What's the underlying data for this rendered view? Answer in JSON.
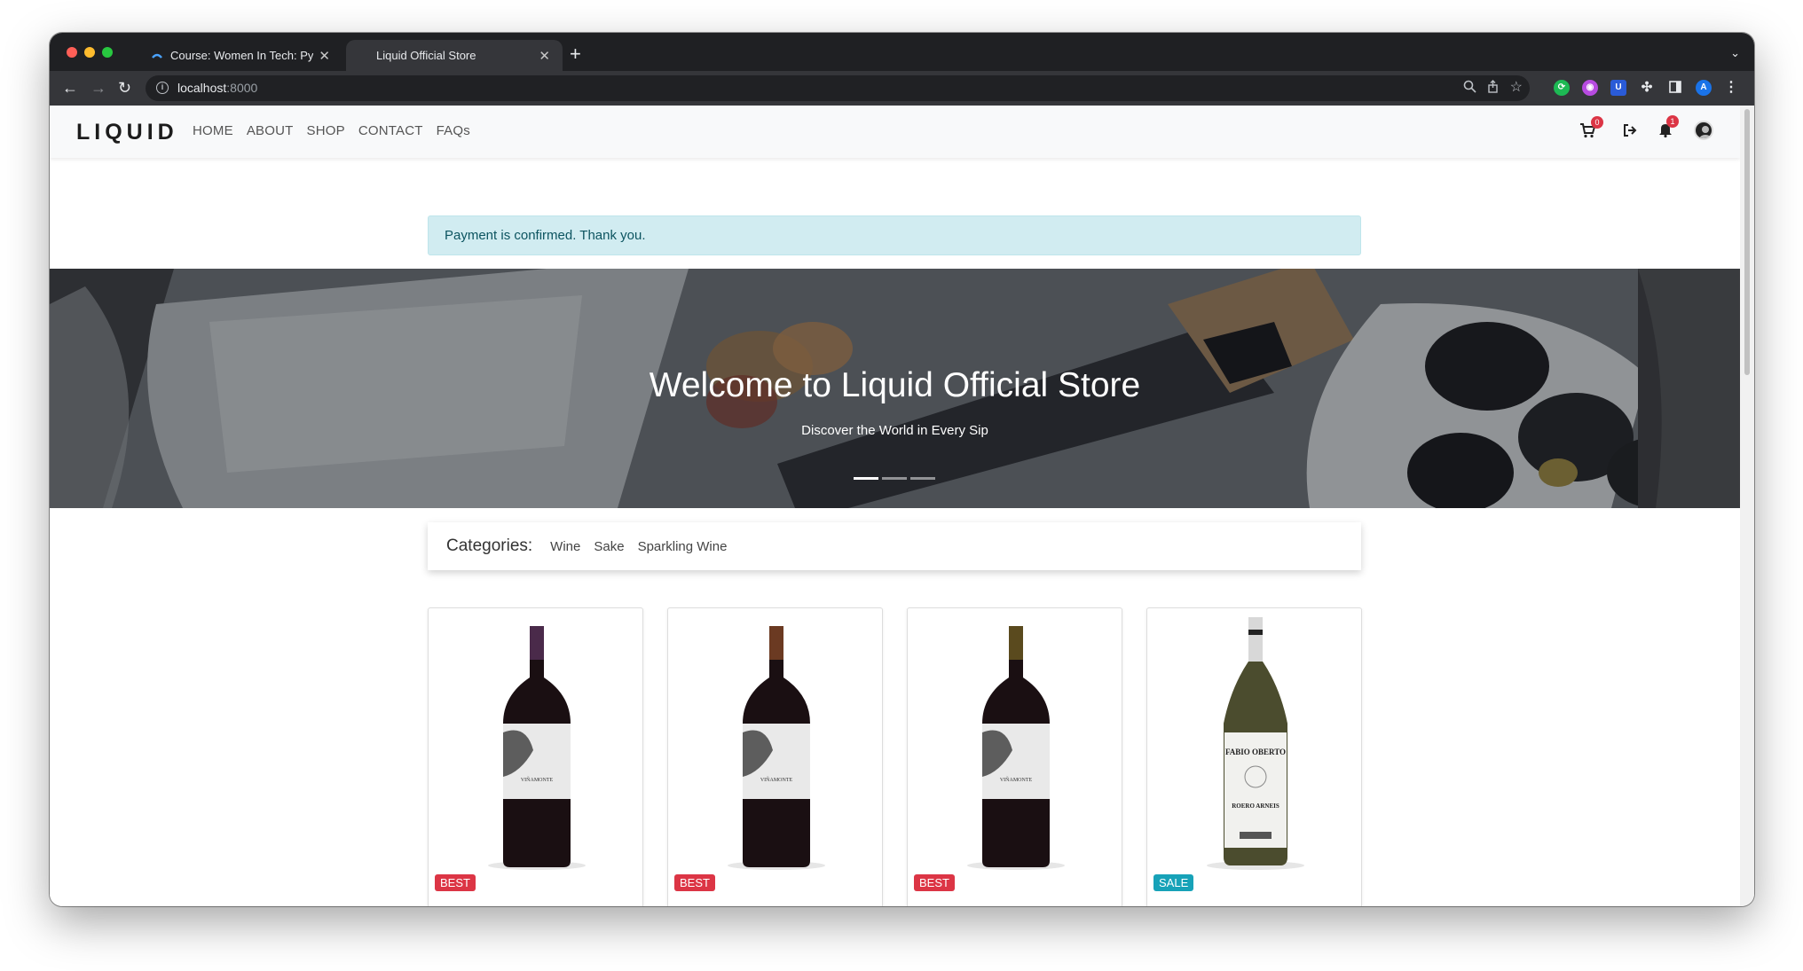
{
  "browser": {
    "tabs": [
      {
        "title": "Course: Women In Tech: Pytho",
        "active": false
      },
      {
        "title": "Liquid Official Store",
        "active": true
      }
    ],
    "url_host": "localhost",
    "url_port": ":8000",
    "profile_initial": "A"
  },
  "site": {
    "logo": "LIQUID",
    "nav": [
      "HOME",
      "ABOUT",
      "SHOP",
      "CONTACT",
      "FAQs"
    ],
    "cart_count": "0",
    "notification_count": "1"
  },
  "alert": {
    "message": "Payment is confirmed. Thank you."
  },
  "hero": {
    "title": "Welcome to Liquid Official Store",
    "subtitle": "Discover the World in Every Sip",
    "slides": 3,
    "active_slide": 1
  },
  "categories": {
    "label": "Categories:",
    "items": [
      "Wine",
      "Sake",
      "Sparkling Wine"
    ]
  },
  "products": [
    {
      "label_text": "VIÑAMONTE",
      "tag": "BEST",
      "tag_color": "#dc3545",
      "capsule_color": "#4a2a4a"
    },
    {
      "label_text": "VIÑAMONTE",
      "tag": "BEST",
      "tag_color": "#dc3545",
      "capsule_color": "#6b3a22"
    },
    {
      "label_text": "VIÑAMONTE",
      "tag": "BEST",
      "tag_color": "#dc3545",
      "capsule_color": "#5a4a1e"
    },
    {
      "label_text": "FABIO OBERTO",
      "label_text2": "ROERO ARNEIS",
      "tag": "SALE",
      "tag_color": "#17a2b8",
      "capsule_color": "#d8d8d8"
    }
  ],
  "colors": {
    "chrome_dark": "#1f2023",
    "alert_bg": "#d1ecf1",
    "alert_text": "#0c5460",
    "badge": "#dc3545",
    "sale": "#17a2b8"
  }
}
